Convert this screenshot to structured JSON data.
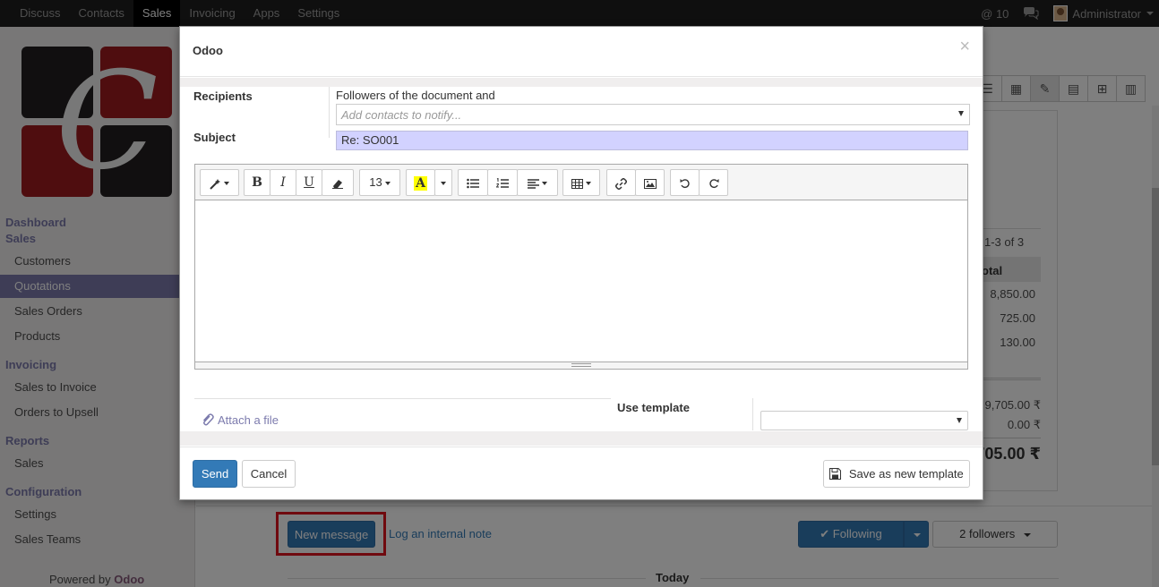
{
  "topbar": {
    "menu": [
      "Discuss",
      "Contacts",
      "Sales",
      "Invoicing",
      "Apps",
      "Settings"
    ],
    "active_menu": "Sales",
    "notifications": "@ 10",
    "user": "Administrator"
  },
  "sidebar": {
    "sections": {
      "dashboard": "Dashboard",
      "sales": "Sales",
      "customers": "Customers",
      "quotations": "Quotations",
      "sales_orders": "Sales Orders",
      "products": "Products",
      "invoicing": "Invoicing",
      "sales_to_invoice": "Sales to Invoice",
      "orders_to_upsell": "Orders to Upsell",
      "reports": "Reports",
      "reports_sales": "Sales",
      "configuration": "Configuration",
      "settings": "Settings",
      "sales_teams": "Sales Teams"
    },
    "powered_by": "Powered by",
    "powered_brand": "Odoo"
  },
  "background": {
    "pager": "1-3 of 3",
    "col_total": "otal",
    "amounts": [
      "8,850.00",
      "725.00",
      "130.00"
    ],
    "untaxed": "9,705.00 ₹",
    "taxes": "0.00 ₹",
    "total": "705.00 ₹"
  },
  "chatter": {
    "new_message": "New message",
    "log_note": "Log an internal note",
    "following": "Following",
    "followers": "2 followers",
    "today": "Today"
  },
  "modal": {
    "title": "Odoo",
    "close": "×",
    "recipients_label": "Recipients",
    "recipients_text": "Followers of the document and",
    "contacts_placeholder": "Add contacts to notify...",
    "subject_label": "Subject",
    "subject_value": "Re: SO001",
    "font_size": "13",
    "attach_label": "Attach a file",
    "use_template_label": "Use template",
    "template_value": "",
    "send": "Send",
    "cancel": "Cancel",
    "save_template": "Save as new template"
  },
  "colors": {
    "accent": "#7c7bad",
    "primary": "#337ab7",
    "highlight_box": "#e0141e",
    "subject_bg": "#d2d2ff"
  }
}
